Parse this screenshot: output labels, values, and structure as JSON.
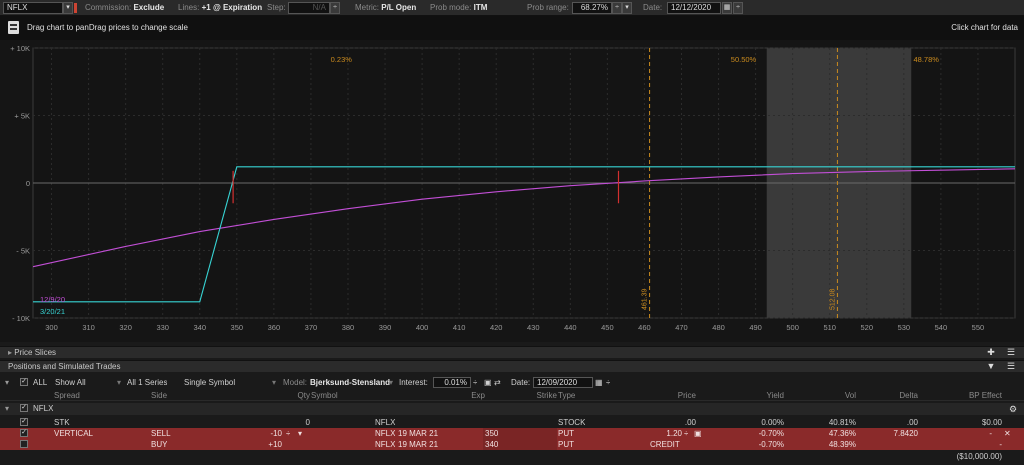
{
  "toolbar": {
    "symbol": "NFLX",
    "commission_label": "Commission:",
    "commission_value": "Exclude",
    "lines_label": "Lines:",
    "lines_value": "+1 @ Expiration",
    "step_label": "Step:",
    "step_value": "N/A",
    "metric_label": "Metric:",
    "metric_value": "P/L Open",
    "prob_mode_label": "Prob mode:",
    "prob_mode_value": "ITM",
    "prob_range_label": "Prob range:",
    "prob_range_value": "68.27%",
    "date_label": "Date:",
    "date_value": "12/12/2020"
  },
  "subheader": {
    "drag_hint": "Drag chart to panDrag prices to change scale",
    "click_hint": "Click chart for data"
  },
  "colors": {
    "magenta": "#c24fd6",
    "cyan": "#37d3d3",
    "orange": "#c98a1e",
    "row_red": "#8a2a2a"
  },
  "chart_data": {
    "type": "line",
    "x_ticks": [
      "300",
      "310",
      "320",
      "330",
      "340",
      "350",
      "360",
      "370",
      "380",
      "390",
      "400",
      "410",
      "420",
      "430",
      "440",
      "450",
      "460",
      "470",
      "480",
      "490",
      "500",
      "510",
      "520",
      "530",
      "540",
      "550"
    ],
    "y_ticks": [
      "+ 10K",
      "+ 5K",
      "0",
      "- 5K",
      "- 10K"
    ],
    "xlim": [
      295,
      560
    ],
    "ylim": [
      -10000,
      10000
    ],
    "series": [
      {
        "name": "12/9/20",
        "x": [
          295,
          320,
          340,
          360,
          380,
          400,
          420,
          440,
          460,
          480,
          500,
          520,
          540,
          560
        ],
        "y": [
          -6200,
          -4700,
          -3600,
          -2700,
          -1900,
          -1200,
          -650,
          -200,
          150,
          450,
          700,
          850,
          950,
          1050
        ]
      },
      {
        "name": "3/20/21",
        "x": [
          295,
          340,
          350,
          560
        ],
        "y": [
          -8800,
          -8800,
          1200,
          1200
        ]
      }
    ],
    "prob_lines": [
      {
        "x": 461.39,
        "label": "461.39"
      },
      {
        "x": 512.08,
        "label": "512.08"
      }
    ],
    "prob_percentages": [
      "0.23%",
      "50.50%",
      "48.78%"
    ],
    "shaded_range": [
      493,
      532
    ],
    "current_price_markers": [
      349,
      453
    ]
  },
  "positions": {
    "section_price_slices": "Price Slices",
    "section_title": "Positions and Simulated Trades",
    "controls": {
      "all": "ALL",
      "show_all": "Show All",
      "series": "All 1 Series",
      "symbol_mode": "Single Symbol",
      "model_label": "Model:",
      "model_value": "Bjerksund-Stensland",
      "interest_label": "Interest:",
      "interest_value": "0.01%",
      "date_label": "Date:",
      "date_value": "12/09/2020"
    },
    "columns": [
      "Spread",
      "Side",
      "Qty",
      "Symbol",
      "Exp",
      "Strike",
      "Type",
      "Price",
      "Yield",
      "Vol",
      "Delta",
      "BP Effect"
    ],
    "group": "NFLX",
    "rows": [
      {
        "spread": "STK",
        "side": "",
        "qty": "0",
        "symbol": "NFLX",
        "exp": "",
        "strike": "",
        "type": "STOCK",
        "price": ".00",
        "yield": "0.00%",
        "vol": "40.81%",
        "delta": ".00",
        "bp": "$0.00"
      },
      {
        "spread": "VERTICAL",
        "side": "SELL",
        "qty": "-10",
        "symbol": "NFLX",
        "exp": "19 MAR 21",
        "strike": "350",
        "type": "PUT",
        "price": "1.20",
        "yield": "-0.70%",
        "vol": "47.36%",
        "delta": "7.8420",
        "bp": "-"
      },
      {
        "spread": "",
        "side": "BUY",
        "qty": "+10",
        "symbol": "NFLX",
        "exp": "19 MAR 21",
        "strike": "340",
        "type": "PUT",
        "price": "CREDIT",
        "yield": "-0.70%",
        "vol": "48.39%",
        "delta": "",
        "bp": "-"
      }
    ],
    "total_bp": "($10,000.00)"
  }
}
